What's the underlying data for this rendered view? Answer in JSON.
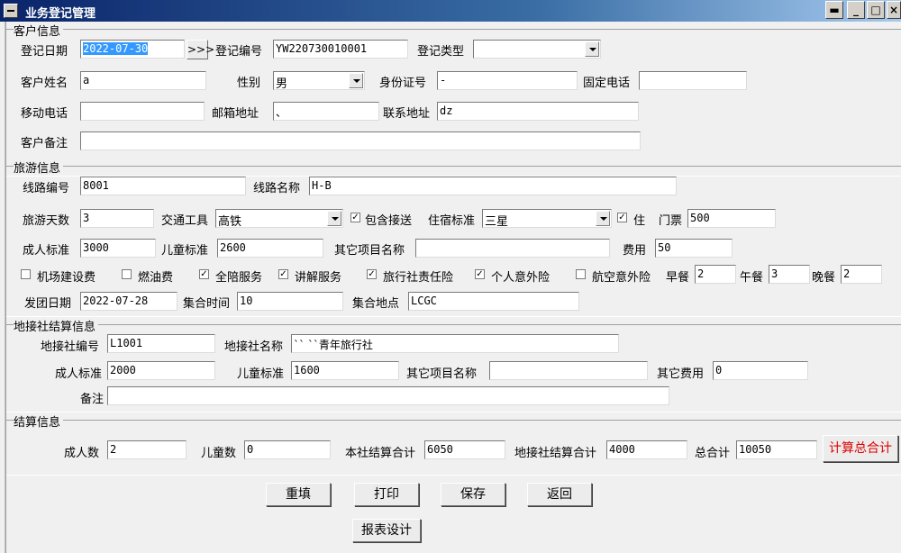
{
  "window": {
    "title": "业务登记管理"
  },
  "customer": {
    "section": "客户信息",
    "reg_date_label": "登记日期",
    "reg_date": "2022-07-30",
    "date_btn": ">>>",
    "reg_no_label": "登记编号",
    "reg_no": "YW220730010001",
    "reg_type_label": "登记类型",
    "reg_type": "",
    "name_label": "客户姓名",
    "name": "a",
    "gender_label": "性别",
    "gender": "男",
    "id_label": "身份证号",
    "id": "-",
    "phone_label": "固定电话",
    "phone": "",
    "mobile_label": "移动电话",
    "mobile": "",
    "email_label": "邮箱地址",
    "email": "、",
    "address_label": "联系地址",
    "address": "dz",
    "remark_label": "客户备注",
    "remark": ""
  },
  "tour": {
    "section": "旅游信息",
    "route_no_label": "线路编号",
    "route_no": "8001",
    "route_name_label": "线路名称",
    "route_name": "H-B",
    "days_label": "旅游天数",
    "days": "3",
    "transport_label": "交通工具",
    "transport": "高铁",
    "pickup_label": "包含接送",
    "pickup_checked": true,
    "hotel_label": "住宿标准",
    "hotel": "三星",
    "stay_label": "住",
    "stay_checked": true,
    "ticket_label": "门票",
    "ticket": "500",
    "adult_label": "成人标准",
    "adult": "3000",
    "child_label": "儿童标准",
    "child": "2600",
    "other_label": "其它项目名称",
    "other": "",
    "fee_label": "费用",
    "fee": "50",
    "options": [
      {
        "label": "机场建设费",
        "checked": false
      },
      {
        "label": "燃油费",
        "checked": false
      },
      {
        "label": "全陪服务",
        "checked": true
      },
      {
        "label": "讲解服务",
        "checked": true
      },
      {
        "label": "旅行社责任险",
        "checked": true
      },
      {
        "label": "个人意外险",
        "checked": true
      },
      {
        "label": "航空意外险",
        "checked": false
      }
    ],
    "breakfast_label": "早餐",
    "breakfast": "2",
    "lunch_label": "午餐",
    "lunch": "3",
    "dinner_label": "晚餐",
    "dinner": "2",
    "depart_label": "发团日期",
    "depart": "2022-07-28",
    "meet_time_label": "集合时间",
    "meet_time": "10",
    "meet_place_label": "集合地点",
    "meet_place": "LCGC"
  },
  "local": {
    "section": "地接社结算信息",
    "no_label": "地接社编号",
    "no": "L1001",
    "name_label": "地接社名称",
    "name": "`` ``青年旅行社",
    "adult_label": "成人标准",
    "adult": "2000",
    "child_label": "儿童标准",
    "child": "1600",
    "other_label": "其它项目名称",
    "other": "",
    "other_fee_label": "其它费用",
    "other_fee": "0",
    "remark_label": "备注",
    "remark": ""
  },
  "settle": {
    "section": "结算信息",
    "adults_label": "成人数",
    "adults": "2",
    "children_label": "儿童数",
    "children": "0",
    "own_total_label": "本社结算合计",
    "own_total": "6050",
    "local_total_label": "地接社结算合计",
    "local_total": "4000",
    "total_label": "总合计",
    "total": "10050",
    "calc_btn": "计算总合计"
  },
  "buttons": {
    "reset": "重填",
    "print": "打印",
    "save": "保存",
    "back": "返回",
    "report": "报表设计"
  }
}
